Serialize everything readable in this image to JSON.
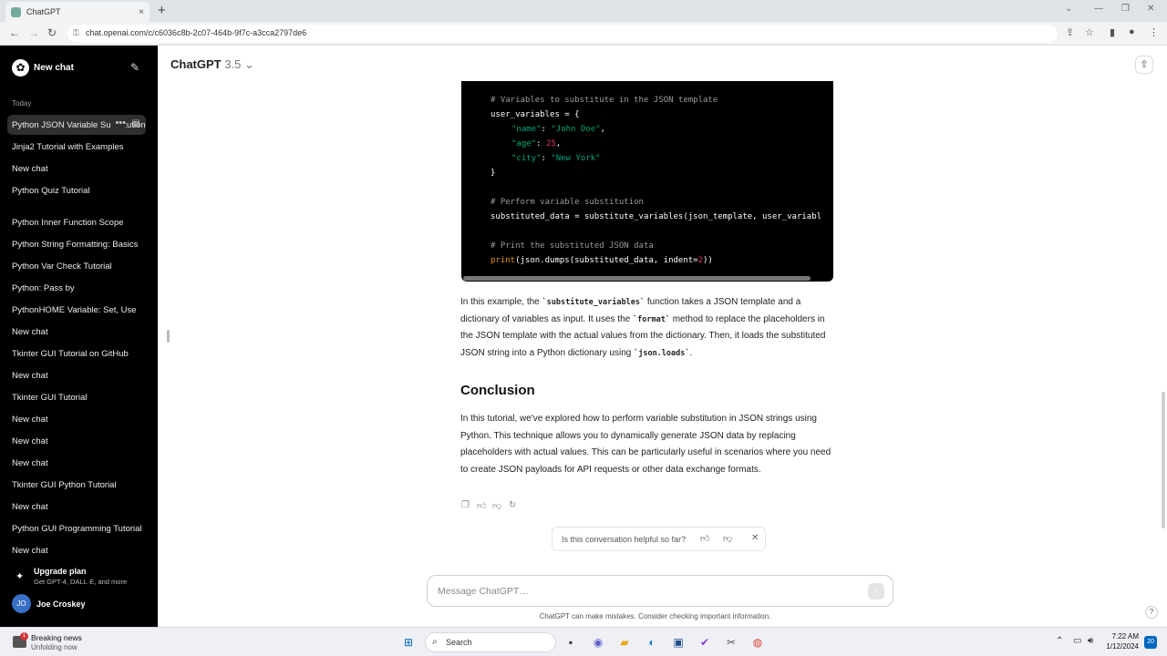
{
  "browser": {
    "tab_title": "ChatGPT",
    "tab_close": "×",
    "new_tab": "+",
    "url": "chat.openai.com/c/c6036c8b-2c07-464b-9f7c-a3cca2797de6"
  },
  "sidebar": {
    "new_chat": "New chat",
    "section_today": "Today",
    "items": [
      {
        "label": "Python JSON Variable Substitution",
        "active": true
      },
      {
        "label": "Jinja2 Tutorial with Examples"
      },
      {
        "label": "New chat"
      },
      {
        "label": "Python Quiz Tutorial"
      },
      {
        "label": "Python Inner Function Scope"
      },
      {
        "label": "Python String Formatting: Basics"
      },
      {
        "label": "Python Var Check Tutorial"
      },
      {
        "label": "Python: Pass by"
      },
      {
        "label": "PythonHOME Variable: Set, Use"
      },
      {
        "label": "New chat"
      },
      {
        "label": "Tkinter GUI Tutorial on GitHub"
      },
      {
        "label": "New chat"
      },
      {
        "label": "Tkinter GUI Tutorial"
      },
      {
        "label": "New chat"
      },
      {
        "label": "New chat"
      },
      {
        "label": "New chat"
      },
      {
        "label": "Tkinter GUI Python Tutorial"
      },
      {
        "label": "New chat"
      },
      {
        "label": "Python GUI Programming Tutorial"
      },
      {
        "label": "New chat"
      }
    ],
    "upgrade_title": "Upgrade plan",
    "upgrade_sub": "Get GPT-4, DALL·E, and more",
    "user_initials": "JO",
    "user_name": "Joe Croskey"
  },
  "header": {
    "model": "ChatGPT",
    "version": "3.5",
    "chevron": "⌄"
  },
  "code": {
    "comment1": "# Variables to substitute in the JSON template",
    "line_user_vars": "user_variables = {",
    "k_name": "\"name\"",
    "v_name": "\"John Doe\"",
    "k_age": "\"age\"",
    "v_age": "25",
    "k_city": "\"city\"",
    "v_city": "\"New York\"",
    "close_brace": "}",
    "comment2": "# Perform variable substitution",
    "line_subst": "substituted_data = substitute_variables(json_template, user_variabl",
    "comment3": "# Print the substituted JSON data",
    "print_fn": "print",
    "print_args": "(json.dumps(substituted_data, indent=",
    "print_num": "2",
    "print_end": "))"
  },
  "answer": {
    "p1_a": "In this example, the ",
    "p1_code1": "`substitute_variables`",
    "p1_b": " function takes a JSON template and a dictionary of variables as input. It uses the ",
    "p1_code2": "`format`",
    "p1_c": " method to replace the placeholders in the JSON template with the actual values from the dictionary. Then, it loads the substituted JSON string into a Python dictionary using ",
    "p1_code3": "`json.loads`",
    "p1_d": ".",
    "heading": "Conclusion",
    "p2": "In this tutorial, we've explored how to perform variable substitution in JSON strings using Python. This technique allows you to dynamically generate JSON data by replacing placeholders with actual values. This can be particularly useful in scenarios where you need to create JSON payloads for API requests or other data exchange formats."
  },
  "feedback": {
    "question": "Is this conversation helpful so far?"
  },
  "composer": {
    "placeholder": "Message ChatGPT…",
    "disclaimer": "ChatGPT can make mistakes. Consider checking important information.",
    "help": "?"
  },
  "taskbar": {
    "news_badge": "1",
    "news_title": "Breaking news",
    "news_sub": "Unfolding now",
    "search": "Search",
    "time": "7:22 AM",
    "date": "1/12/2024",
    "notifications": "20"
  }
}
